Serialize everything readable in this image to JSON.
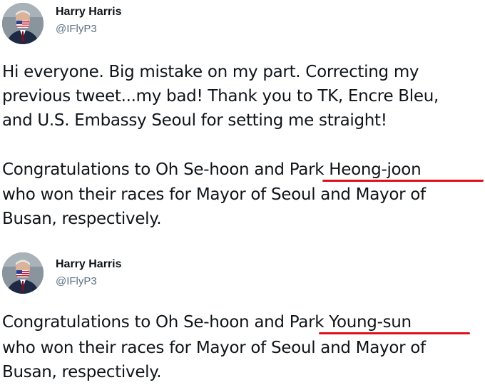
{
  "tweet_1": {
    "author": {
      "name": "Harry Harris",
      "handle": "@IFlyP3"
    },
    "paragraph_1": [
      "Hi everyone. Big mistake on my part. Correcting my",
      "previous tweet...my bad!  Thank you to TK, Encre Bleu,",
      "and U.S. Embassy Seoul for setting me straight!"
    ],
    "paragraph_2": {
      "line_1_prefix": "Congratulations to Oh Se-hoon and ",
      "line_1_highlight": "Park Heong-joon",
      "line_2": "who won their races for Mayor of Seoul and Mayor of",
      "line_3": "Busan, respectively."
    }
  },
  "tweet_2": {
    "author": {
      "name": "Harry Harris",
      "handle": "@IFlyP3"
    },
    "paragraph_1": {
      "line_1_prefix": "Congratulations to Oh Se-hoon and ",
      "line_1_highlight": "Park Young-sun",
      "line_2": "who won their races for Mayor of Seoul and Mayor of",
      "line_3": "Busan, respectively."
    }
  },
  "colors": {
    "underline": "#e0101b",
    "handle_gray": "#5b7083",
    "text": "#0f1419"
  },
  "icons": [
    "avatar-photo"
  ]
}
